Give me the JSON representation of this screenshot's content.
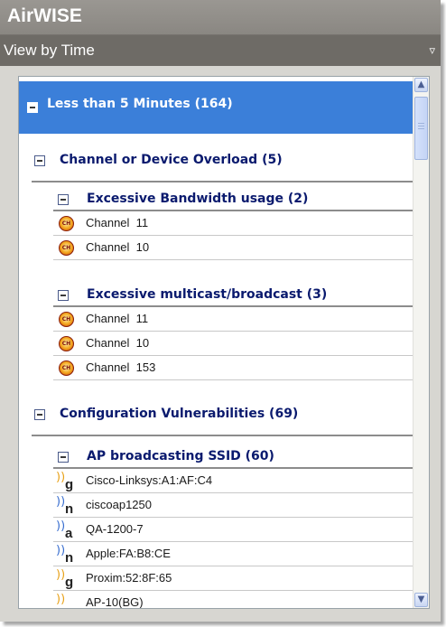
{
  "app": {
    "title": "AirWISE"
  },
  "view_selector": {
    "label": "View by Time"
  },
  "tree": {
    "level1": {
      "label": "Less than 5 Minutes (164)"
    },
    "groups": [
      {
        "label": "Channel or Device Overload (5)"
      },
      {
        "label": "Configuration Vulnerabilities (69)"
      }
    ],
    "subgroups": [
      {
        "label": "Excessive Bandwidth usage (2)",
        "items": [
          "Channel  11",
          "Channel  10"
        ]
      },
      {
        "label": "Excessive multicast/broadcast (3)",
        "items": [
          "Channel  11",
          "Channel  10",
          "Channel  153"
        ]
      },
      {
        "label": "AP broadcasting SSID (60)",
        "items": [
          {
            "name": "Cisco-Linksys:A1:AF:C4",
            "icon": "ap-icon-g"
          },
          {
            "name": "ciscoap1250",
            "icon": "ap-icon-n"
          },
          {
            "name": "QA-1200-7",
            "icon": "ap-icon-a"
          },
          {
            "name": "Apple:FA:B8:CE",
            "icon": "ap-icon-n"
          },
          {
            "name": "Proxim:52:8F:65",
            "icon": "ap-icon-g"
          },
          {
            "name": "AP-10(BG)",
            "icon": "ap-icon-bg"
          }
        ]
      }
    ],
    "channel_icon_text": "CH",
    "ap_suffix": {
      "g": "g",
      "n": "n",
      "a": "a"
    }
  },
  "colors": {
    "accent": "#3b7fd9",
    "header_bg": "#8f8c87",
    "view_bar_bg": "#6e6b66",
    "group_text": "#0a1a6e"
  }
}
